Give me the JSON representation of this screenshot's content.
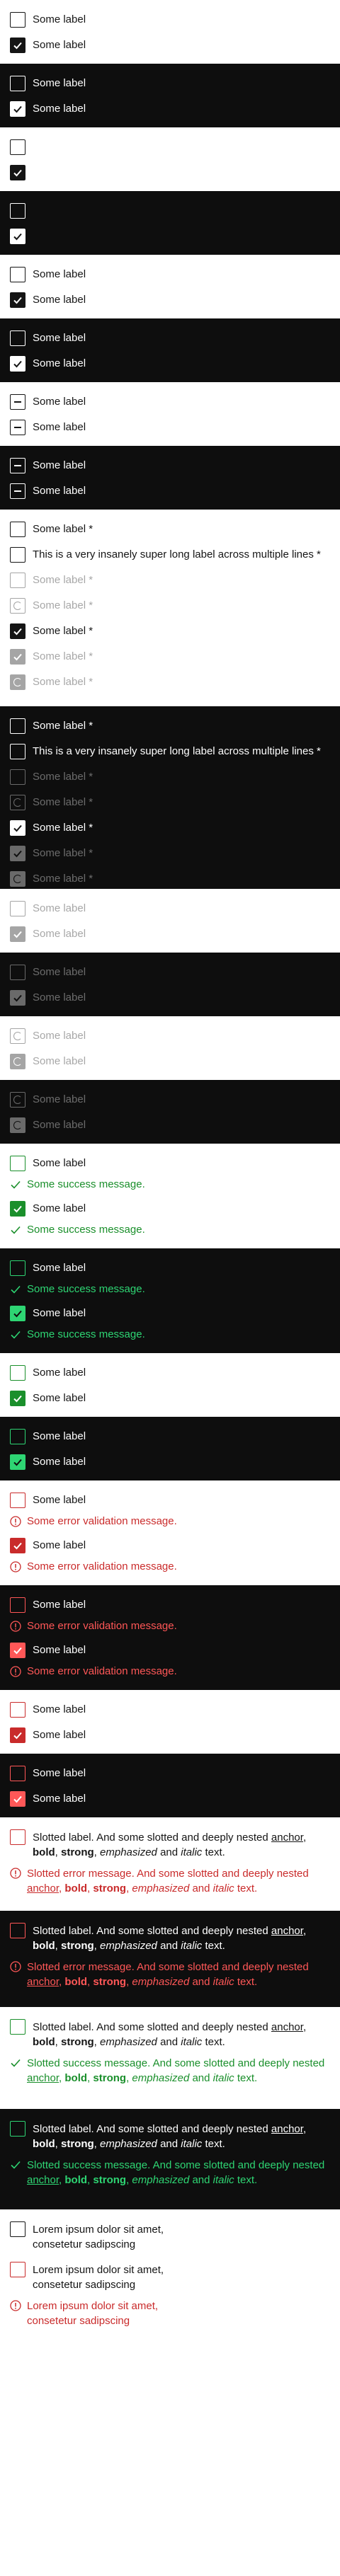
{
  "label": "Some label",
  "long_label": "This is a very insanely super long label across multiple lines",
  "success_msg": "Some success message.",
  "error_msg": "Some error validation message.",
  "slotted": {
    "label_start": "Slotted label. And some slotted and deeply nested ",
    "anchor": "anchor",
    "bold": "bold",
    "strong": "strong",
    "emphasized": "emphasized",
    "and": " and ",
    "italic": "italic",
    "text_end": " text.",
    "error_start": "Slotted error message. And some slotted and deeply nested ",
    "success_start": "Slotted success message. And some slotted and deeply nested ",
    "comma": ", "
  },
  "lorem": "Lorem ipsum dolor sit amet, consetetur sadipscing",
  "colors": {
    "dark_bg": "#0e0e0e",
    "success_light": "#1a8f2b",
    "success_dark": "#2ed573",
    "error_light": "#c92b2b",
    "error_dark": "#ff5757"
  },
  "icons": [
    "check-icon",
    "minus-icon",
    "spinner-icon",
    "success-check-icon",
    "error-exclamation-icon"
  ]
}
